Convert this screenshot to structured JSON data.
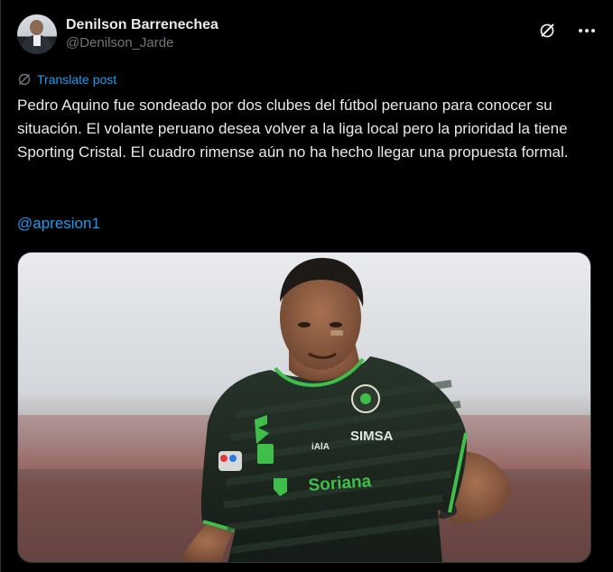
{
  "author": {
    "display_name": "Denilson Barrenechea",
    "handle": "@Denilson_Jarde"
  },
  "header_icons": {
    "grok": "grok-slash-icon",
    "more": "more-dots-icon"
  },
  "translate": {
    "label": "Translate post",
    "icon": "translate-icon"
  },
  "post": {
    "text": "Pedro Aquino fue sondeado por dos clubes del fútbol peruano para conocer su situación. El volante peruano desea volver a la liga local pero la prioridad la tiene Sporting Cristal. El cuadro rimense aún no ha hecho llegar una propuesta formal.",
    "mention": "@apresion1"
  },
  "media": {
    "jersey_text": {
      "sponsor_chest": "Soriana",
      "sponsor_top": "SIMSA",
      "brand": "iAlA"
    }
  },
  "colors": {
    "background": "#000000",
    "text": "#e7e9ea",
    "muted": "#71767b",
    "accent": "#1d9bf0",
    "border": "#2f3336",
    "jersey": "#1e2a22",
    "jersey_green": "#3fbf4a"
  }
}
